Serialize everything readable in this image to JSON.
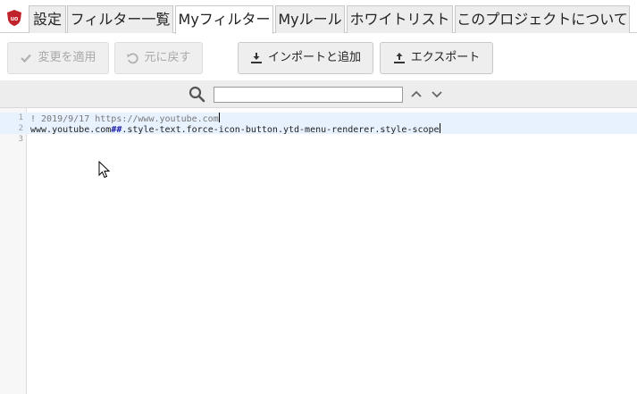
{
  "tabs": [
    {
      "id": "settings",
      "label": "設定",
      "active": false
    },
    {
      "id": "filter-lists",
      "label": "フィルター一覧",
      "active": false
    },
    {
      "id": "my-filters",
      "label": "Myフィルター",
      "active": true
    },
    {
      "id": "my-rules",
      "label": "Myルール",
      "active": false
    },
    {
      "id": "whitelist",
      "label": "ホワイトリスト",
      "active": false
    },
    {
      "id": "about",
      "label": "このプロジェクトについて",
      "active": false
    }
  ],
  "toolbar": {
    "apply_label": "変更を適用",
    "revert_label": "元に戻す",
    "import_label": "インポートと追加",
    "export_label": "エクスポート"
  },
  "search": {
    "value": "",
    "placeholder": ""
  },
  "editor": {
    "lines": [
      {
        "number": "1",
        "comment": "! 2019/9/17 https://www.youtube.com"
      },
      {
        "number": "2",
        "domain": "www.youtube.com",
        "separator": "##",
        "selector": ".style-text.force-icon-button.ytd-menu-renderer.style-scope"
      },
      {
        "number": "3",
        "text": ""
      }
    ]
  },
  "colors": {
    "logo_red": "#c0232c",
    "line_highlight": "#e8f2ff",
    "separator": "#1e1ea8"
  }
}
